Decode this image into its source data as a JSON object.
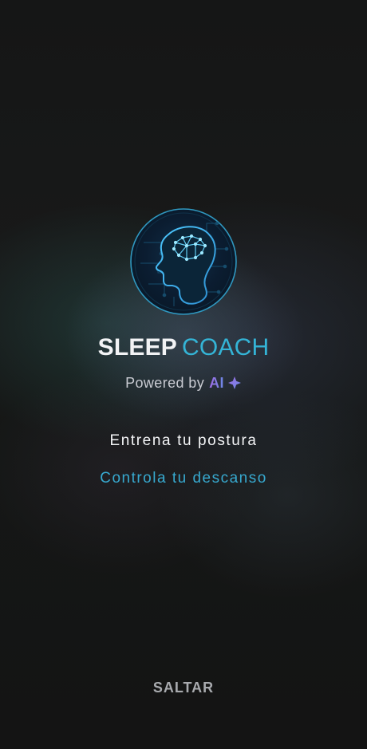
{
  "brand": {
    "part1": "SLEEP",
    "part2": "COACH"
  },
  "powered": {
    "prefix": "Powered by",
    "ai": "AI"
  },
  "taglines": {
    "line1": "Entrena tu postura",
    "line2": "Controla tu descanso"
  },
  "actions": {
    "skip": "SALTAR"
  },
  "icons": {
    "logo": "ai-brain-head-icon",
    "sparkle": "sparkle-icon"
  },
  "colors": {
    "background": "#141515",
    "accent": "#34b4d6",
    "ai_gradient_start": "#9f6be3",
    "ai_gradient_end": "#6b8ae6",
    "skip": "#a8aaae"
  }
}
